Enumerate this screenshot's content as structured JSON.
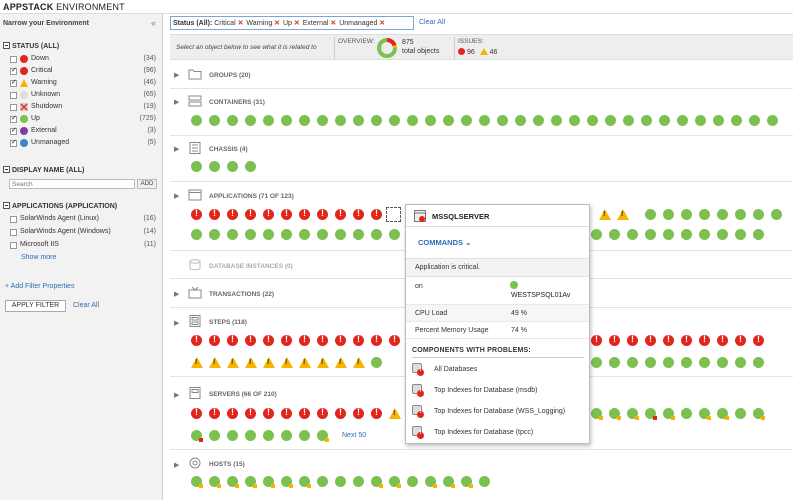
{
  "title": {
    "brand_bold": "APPSTACK",
    "brand_rest": " ENVIRONMENT"
  },
  "sidebar": {
    "heading": "Narrow your Environment",
    "collapse_icon": "«",
    "status_section": "STATUS (ALL)",
    "status_items": [
      {
        "label": "Down",
        "count": "(34)",
        "checked": false,
        "icon": "down-icon",
        "color": "#e1251b"
      },
      {
        "label": "Critical",
        "count": "(96)",
        "checked": true,
        "icon": "critical-icon",
        "color": "#e1251b"
      },
      {
        "label": "Warning",
        "count": "(46)",
        "checked": true,
        "icon": "warning-icon",
        "color": "#f5b400"
      },
      {
        "label": "Unknown",
        "count": "(65)",
        "checked": false,
        "icon": "unknown-icon",
        "color": "#c0c0c0"
      },
      {
        "label": "Shutdown",
        "count": "(19)",
        "checked": false,
        "icon": "shutdown-icon",
        "color": "#d9534f"
      },
      {
        "label": "Up",
        "count": "(725)",
        "checked": true,
        "icon": "up-icon",
        "color": "#7cc04f"
      },
      {
        "label": "External",
        "count": "(3)",
        "checked": true,
        "icon": "external-icon",
        "color": "#7b3fa0"
      },
      {
        "label": "Unmanaged",
        "count": "(5)",
        "checked": true,
        "icon": "unmanaged-icon",
        "color": "#3a86c8"
      }
    ],
    "display_section": "DISPLAY NAME (ALL)",
    "search_placeholder": "Search",
    "add_label": "ADD",
    "app_section": "APPLICATIONS (APPLICATION)",
    "app_items": [
      {
        "label": "SolarWinds Agent (Linux)",
        "count": "(16)"
      },
      {
        "label": "SolarWinds Agent (Windows)",
        "count": "(14)"
      },
      {
        "label": "Microsoft IIS",
        "count": "(11)"
      }
    ],
    "show_more": "Show more",
    "add_filter": "+ Add Filter Properties",
    "apply_filter": "APPLY FILTER",
    "clear_all": "Clear All"
  },
  "filterbar": {
    "prefix": "Status (All):",
    "chips": [
      "Critical",
      "Warning",
      "Up",
      "External",
      "Unmanaged"
    ],
    "remove_glyph": "✕",
    "clear_all": "Clear All"
  },
  "infobar": {
    "hint": "Select an object below to see what it is related to",
    "overview_label": "OVERVIEW:",
    "overview_count": "875",
    "overview_total": "total objects",
    "issues_label": "ISSUES:",
    "issues_critical": "96",
    "issues_warning": "46"
  },
  "groups": [
    {
      "title": "GROUPS (20)"
    },
    {
      "title": "CONTAINERS (31)"
    },
    {
      "title": "CHASSIS (4)"
    },
    {
      "title": "APPLICATIONS (71 OF 123)"
    },
    {
      "title": "DATABASE INSTANCES (0)"
    },
    {
      "title": "TRANSACTIONS (22)"
    },
    {
      "title": "STEPS (118)"
    },
    {
      "title": "SERVERS (66 OF 210)"
    },
    {
      "title": "HOSTS (15)"
    }
  ],
  "next50": "Next 50",
  "popup": {
    "title": "MSSQLSERVER",
    "commands": "COMMANDS",
    "status": "Application is critical.",
    "rows": [
      {
        "key": "on",
        "value": "WESTSPSQL01Av"
      },
      {
        "key": "CPU Load",
        "value": "49 %"
      },
      {
        "key": "Percent Memory Usage",
        "value": "74 %"
      }
    ],
    "components_heading": "COMPONENTS WITH PROBLEMS:",
    "components": [
      "All Databases",
      "Top Indexes for Database (msdb)",
      "Top Indexes for Database (WSS_Logging)",
      "Top Indexes for Database (tpcc)"
    ]
  }
}
